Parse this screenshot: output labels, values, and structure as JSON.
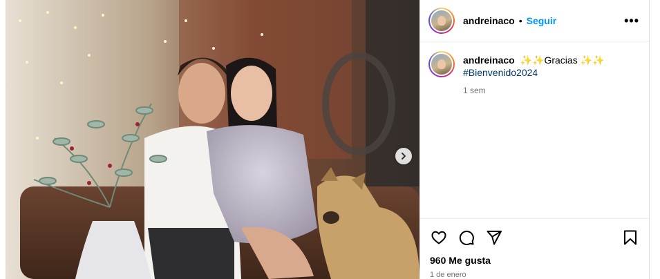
{
  "post": {
    "username": "andreinaco",
    "separator": "•",
    "follow_label": "Seguir",
    "more_label": "•••",
    "caption": {
      "username": "andreinaco",
      "text": "✨✨Gracias ✨✨",
      "hashtag": "#Bienvenido2024",
      "relative_time": "1 sem"
    },
    "likes": "960 Me gusta",
    "date": "1 de enero"
  },
  "icons": {
    "next": "chevron-right-icon",
    "like": "heart-icon",
    "comment": "comment-icon",
    "share": "send-icon",
    "save": "bookmark-icon"
  },
  "colors": {
    "follow": "#0095f6",
    "hashtag": "#00376b",
    "secondary_text": "#737373",
    "border": "#dbdbdb"
  }
}
